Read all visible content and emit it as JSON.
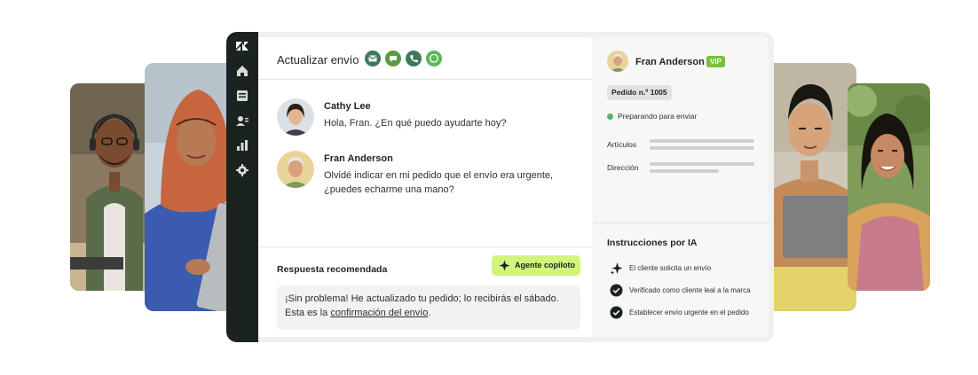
{
  "brand": {
    "rail_color": "#1b2321",
    "accent_lime": "#d1f47b",
    "vip_green": "#7bbf3a",
    "status_green": "#5db35e"
  },
  "rail": {
    "items": [
      {
        "icon": "zendesk-logo-icon"
      },
      {
        "icon": "home-icon"
      },
      {
        "icon": "inbox-icon"
      },
      {
        "icon": "contacts-icon"
      },
      {
        "icon": "reports-icon"
      },
      {
        "icon": "gear-icon"
      }
    ]
  },
  "conversation": {
    "title": "Actualizar envío",
    "channels": [
      {
        "icon": "email-icon",
        "color": "#3d7a5a"
      },
      {
        "icon": "chat-icon",
        "color": "#5c9a3f"
      },
      {
        "icon": "phone-icon",
        "color": "#3d7a5a"
      },
      {
        "icon": "whatsapp-icon",
        "color": "#5bb85c"
      }
    ],
    "messages": [
      {
        "name": "Cathy Lee",
        "text": "Hola, Fran. ¿En qué puedo ayudarte hoy?"
      },
      {
        "name": "Fran Anderson",
        "text": "Olvidé indicar en mi pedido que el envío era urgente, ¿puedes echarme una mano?"
      }
    ],
    "recommended": {
      "label": "Respuesta recomendada",
      "copilot_button": "Agente copiloto",
      "reply_text": "¡Sin problema! He actualizado tu pedido; lo recibirás el sábado. Esta es la ",
      "reply_link": "confirmación del envío",
      "reply_end": "."
    }
  },
  "customer": {
    "name": "Fran Anderson",
    "badge": "VIP",
    "order": "Pedido n.º 1005",
    "status": "Preparando para enviar",
    "fields": [
      "Artículos",
      "Dirección"
    ]
  },
  "ai_instructions": {
    "title": "Instrucciones por IA",
    "items": [
      {
        "icon": "sparkle-icon",
        "label": "El cliente solicita un envío"
      },
      {
        "icon": "check-circle-icon",
        "label": "Verificado como cliente leal a la marca"
      },
      {
        "icon": "check-circle-icon",
        "label": "Establecer envío urgente en el pedido"
      }
    ]
  }
}
